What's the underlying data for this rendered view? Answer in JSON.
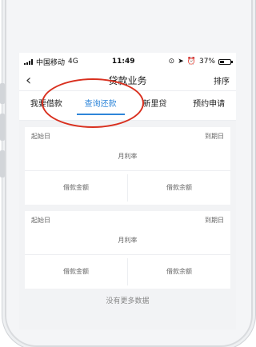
{
  "status_bar": {
    "carrier": "中国移动",
    "network": "4G",
    "time": "11:49",
    "battery": "37%",
    "battery_level": 0.37
  },
  "nav": {
    "title": "贷款业务",
    "action": "排序"
  },
  "tabs": [
    {
      "label": "我要借款"
    },
    {
      "label": "查询还款"
    },
    {
      "label": "新里贷"
    },
    {
      "label": "预约申请"
    }
  ],
  "active_tab": 1,
  "cards": [
    {
      "start_label": "起始日",
      "end_label": "到期日",
      "rate_label": "月利率",
      "amount_label": "借款金额",
      "balance_label": "借款余额"
    },
    {
      "start_label": "起始日",
      "end_label": "到期日",
      "rate_label": "月利率",
      "amount_label": "借款金额",
      "balance_label": "借款余额"
    }
  ],
  "footer": {
    "no_more": "没有更多数据"
  },
  "colors": {
    "accent": "#2f86d9",
    "annotation_circle": "#d9301f"
  }
}
